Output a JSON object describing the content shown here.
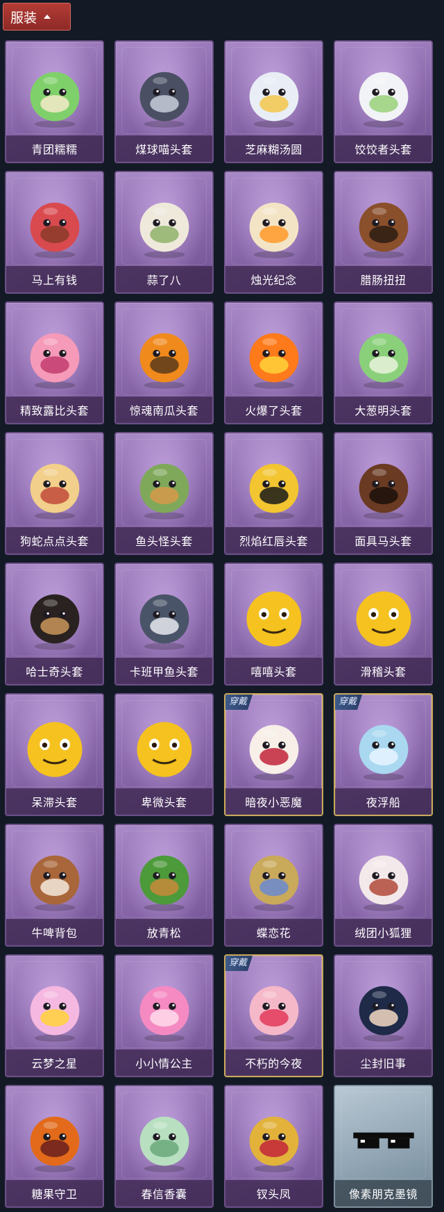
{
  "section": {
    "label": "服装",
    "expanded": true
  },
  "items": [
    {
      "name": "青团糯糯",
      "icon": "green-rice-ball",
      "equipped": false,
      "rarity": "purple"
    },
    {
      "name": "煤球喵头套",
      "icon": "cat-head",
      "equipped": false,
      "rarity": "purple"
    },
    {
      "name": "芝麻糊汤圆",
      "icon": "white-dumpling",
      "equipped": false,
      "rarity": "purple"
    },
    {
      "name": "饺饺者头套",
      "icon": "dumpling-head",
      "equipped": false,
      "rarity": "purple"
    },
    {
      "name": "马上有钱",
      "icon": "red-horse",
      "equipped": false,
      "rarity": "purple"
    },
    {
      "name": "蒜了八",
      "icon": "garlic",
      "equipped": false,
      "rarity": "purple"
    },
    {
      "name": "烛光纪念",
      "icon": "candle",
      "equipped": false,
      "rarity": "purple"
    },
    {
      "name": "腊肠扭扭",
      "icon": "sausage-dog",
      "equipped": false,
      "rarity": "purple"
    },
    {
      "name": "精致露比头套",
      "icon": "pink-glasses-head",
      "equipped": false,
      "rarity": "purple"
    },
    {
      "name": "惊魂南瓜头套",
      "icon": "pumpkin",
      "equipped": false,
      "rarity": "purple"
    },
    {
      "name": "火爆了头套",
      "icon": "fire-spirit",
      "equipped": false,
      "rarity": "purple"
    },
    {
      "name": "大葱明头套",
      "icon": "scallion",
      "equipped": false,
      "rarity": "purple"
    },
    {
      "name": "狗蛇点点头套",
      "icon": "snake-dog",
      "equipped": false,
      "rarity": "purple"
    },
    {
      "name": "鱼头怪头套",
      "icon": "fish-head",
      "equipped": false,
      "rarity": "purple"
    },
    {
      "name": "烈焰红唇头套",
      "icon": "yellow-mouse",
      "equipped": false,
      "rarity": "purple"
    },
    {
      "name": "面具马头套",
      "icon": "horse-mask",
      "equipped": false,
      "rarity": "purple"
    },
    {
      "name": "哈士奇头套",
      "icon": "husky-sunglasses",
      "equipped": false,
      "rarity": "purple"
    },
    {
      "name": "卡班甲鱼头套",
      "icon": "turtle-head",
      "equipped": false,
      "rarity": "purple"
    },
    {
      "name": "嘻嘻头套",
      "icon": "grin-emoji",
      "equipped": false,
      "rarity": "purple"
    },
    {
      "name": "滑稽头套",
      "icon": "sly-emoji",
      "equipped": false,
      "rarity": "purple"
    },
    {
      "name": "呆滞头套",
      "icon": "stare-emoji",
      "equipped": false,
      "rarity": "purple"
    },
    {
      "name": "卑微头套",
      "icon": "timid-emoji",
      "equipped": false,
      "rarity": "purple"
    },
    {
      "name": "暗夜小恶魔",
      "icon": "little-devil",
      "equipped": true,
      "rarity": "purple"
    },
    {
      "name": "夜浮船",
      "icon": "jellyfish",
      "equipped": true,
      "rarity": "purple"
    },
    {
      "name": "牛啤背包",
      "icon": "cow-beer-backpack",
      "equipped": false,
      "rarity": "purple"
    },
    {
      "name": "放青松",
      "icon": "pine-pot",
      "equipped": false,
      "rarity": "purple"
    },
    {
      "name": "蝶恋花",
      "icon": "butterfly-ornament",
      "equipped": false,
      "rarity": "purple"
    },
    {
      "name": "绒团小狐狸",
      "icon": "fluffy-fox",
      "equipped": false,
      "rarity": "purple"
    },
    {
      "name": "云梦之星",
      "icon": "unicorn-star",
      "equipped": false,
      "rarity": "purple"
    },
    {
      "name": "小小情公主",
      "icon": "pink-princess",
      "equipped": false,
      "rarity": "purple"
    },
    {
      "name": "不朽的今夜",
      "icon": "cat-dessert",
      "equipped": true,
      "rarity": "purple"
    },
    {
      "name": "尘封旧事",
      "icon": "chibi-prince",
      "equipped": false,
      "rarity": "purple"
    },
    {
      "name": "糖果守卫",
      "icon": "candy-guard",
      "equipped": false,
      "rarity": "purple"
    },
    {
      "name": "春信香囊",
      "icon": "sachet",
      "equipped": false,
      "rarity": "purple"
    },
    {
      "name": "钗头凤",
      "icon": "phoenix-crown",
      "equipped": false,
      "rarity": "purple"
    },
    {
      "name": "像素朋克墨镜",
      "icon": "pixel-sunglasses",
      "equipped": false,
      "rarity": "silver"
    }
  ],
  "equipped_badge": "穿戴"
}
